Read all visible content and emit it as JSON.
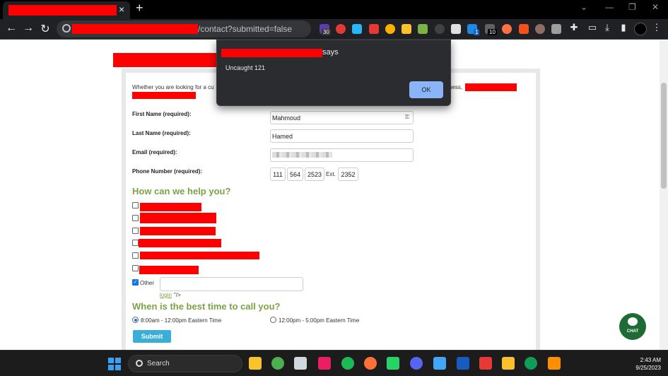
{
  "browser": {
    "tab_close": "×",
    "new_tab": "+",
    "window_controls": [
      "⌄",
      "—",
      "❐",
      "✕"
    ],
    "url_suffix": "/contact?submitted=false",
    "extension_badges": [
      "30",
      "1",
      "10"
    ]
  },
  "dialog": {
    "says": "says",
    "message": "Uncaught 121",
    "ok_label": "OK"
  },
  "form": {
    "intro_text": "Whether you are looking for a cu",
    "intro_tail": "ness,",
    "fields": [
      {
        "label": "First Name (required):",
        "value": "Mahmoud"
      },
      {
        "label": "Last Name (required):",
        "value": "Hamed"
      },
      {
        "label": "Email (required):",
        "value": ""
      },
      {
        "label": "Phone Number (required):",
        "value": ""
      }
    ],
    "phone": {
      "area": "111",
      "prefix": "564",
      "line": "2523",
      "ext_label": "Ext.",
      "ext": "2352"
    },
    "help_title": "How can we help you?",
    "other_label": "Other",
    "login_link": "login",
    "login_tail": "\"/>",
    "time_title": "When is the best time to call you?",
    "time_options": [
      "8:00am - 12:00pm Eastern Time",
      "12:00pm - 5:00pm Eastern Time"
    ],
    "submit_label": "Submit"
  },
  "chat": {
    "label": "CHAT"
  },
  "taskbar": {
    "search_label": "Search",
    "time": "2:43 AM",
    "date": "9/25/2023"
  },
  "colors": {
    "accent_green": "#7aa344",
    "submit_blue": "#3aaed8",
    "chat_green": "#1e6b35",
    "dialog_button": "#8ab4f8"
  }
}
